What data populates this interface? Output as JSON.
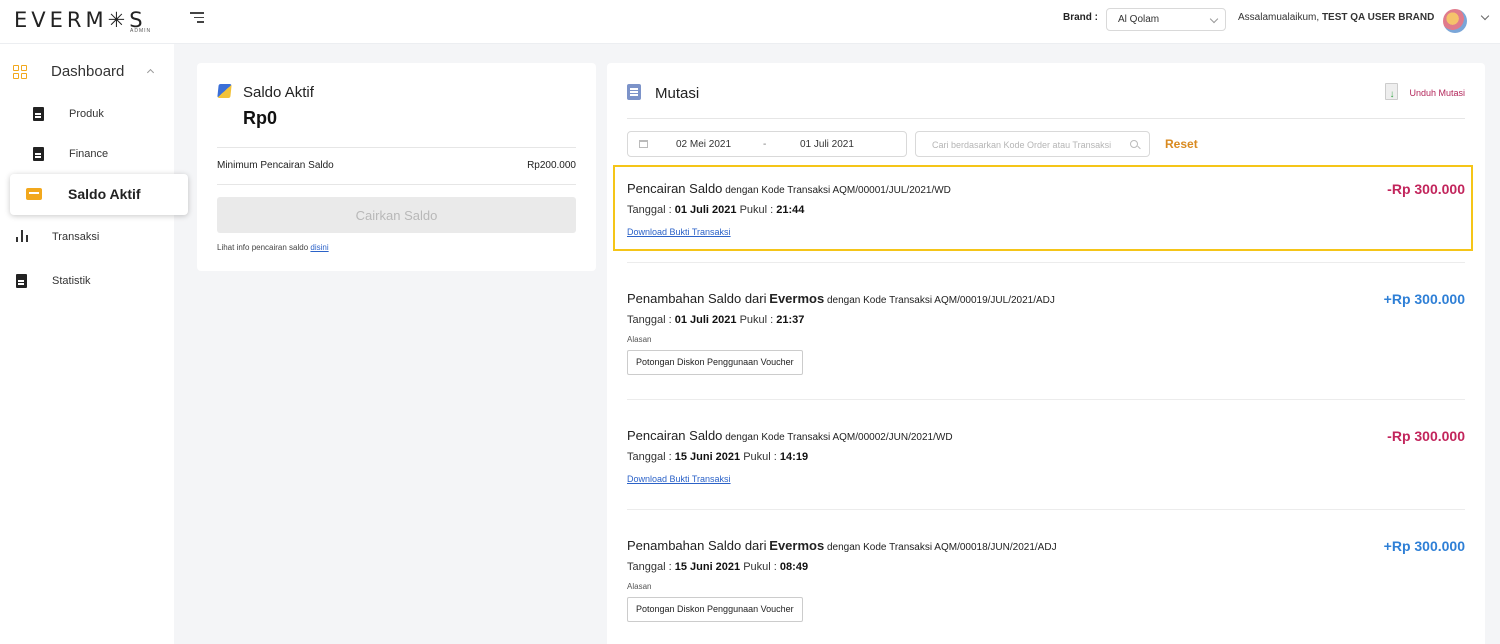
{
  "app": {
    "logo": "EVERM✳S",
    "logo_sub": "ADMIN"
  },
  "topbar": {
    "brand_label": "Brand :",
    "brand_value": "Al Qolam",
    "greeting_prefix": "Assalamualaikum,",
    "greeting_user": "TEST QA USER BRAND"
  },
  "sidebar": {
    "dashboard": "Dashboard",
    "items": [
      {
        "label": "Produk",
        "icon": "document-icon"
      },
      {
        "label": "Finance",
        "icon": "document-icon"
      },
      {
        "label": "Saldo Aktif",
        "icon": "card-icon",
        "active": true
      },
      {
        "label": "Transaksi",
        "icon": "bar-chart-icon"
      },
      {
        "label": "Statistik",
        "icon": "document-icon"
      }
    ]
  },
  "saldo": {
    "title": "Saldo Aktif",
    "amount": "Rp0",
    "min_label": "Minimum Pencairan Saldo",
    "min_value": "Rp200.000",
    "button": "Cairkan Saldo",
    "info_text": "Lihat info pencairan saldo",
    "info_link": "disini"
  },
  "mutasi": {
    "title": "Mutasi",
    "download_label": "Unduh Mutasi",
    "date_start": "02 Mei 2021",
    "date_sep": "-",
    "date_end": "01 Juli 2021",
    "search_placeholder": "Cari berdasarkan Kode Order atau Transaksi",
    "reset": "Reset",
    "entries": [
      {
        "title_main": "Pencairan Saldo",
        "title_rest": "dengan Kode Transaksi AQM/00001/JUL/2021/WD",
        "amount": "-Rp 300.000",
        "date_label": "Tanggal :",
        "date": "01 Juli 2021",
        "time_label": "Pukul :",
        "time": "21:44",
        "link": "Download Bukti Transaksi"
      },
      {
        "title_main": "Penambahan Saldo dari",
        "title_bold": "Evermos",
        "title_rest": "dengan Kode Transaksi AQM/00019/JUL/2021/ADJ",
        "amount": "+Rp 300.000",
        "date_label": "Tanggal :",
        "date": "01 Juli 2021",
        "time_label": "Pukul :",
        "time": "21:37",
        "reason_label": "Alasan",
        "reason": "Potongan Diskon Penggunaan Voucher"
      },
      {
        "title_main": "Pencairan Saldo",
        "title_rest": "dengan Kode Transaksi AQM/00002/JUN/2021/WD",
        "amount": "-Rp 300.000",
        "date_label": "Tanggal :",
        "date": "15 Juni 2021",
        "time_label": "Pukul :",
        "time": "14:19",
        "link": "Download Bukti Transaksi"
      },
      {
        "title_main": "Penambahan Saldo dari",
        "title_bold": "Evermos",
        "title_rest": "dengan Kode Transaksi AQM/00018/JUN/2021/ADJ",
        "amount": "+Rp 300.000",
        "date_label": "Tanggal :",
        "date": "15 Juni 2021",
        "time_label": "Pukul :",
        "time": "08:49",
        "reason_label": "Alasan",
        "reason": "Potongan Diskon Penggunaan Voucher"
      }
    ]
  },
  "colors": {
    "accent": "#f2a81d",
    "negative": "#c2255c",
    "positive": "#2e7fd6",
    "highlight": "#f5c518"
  }
}
